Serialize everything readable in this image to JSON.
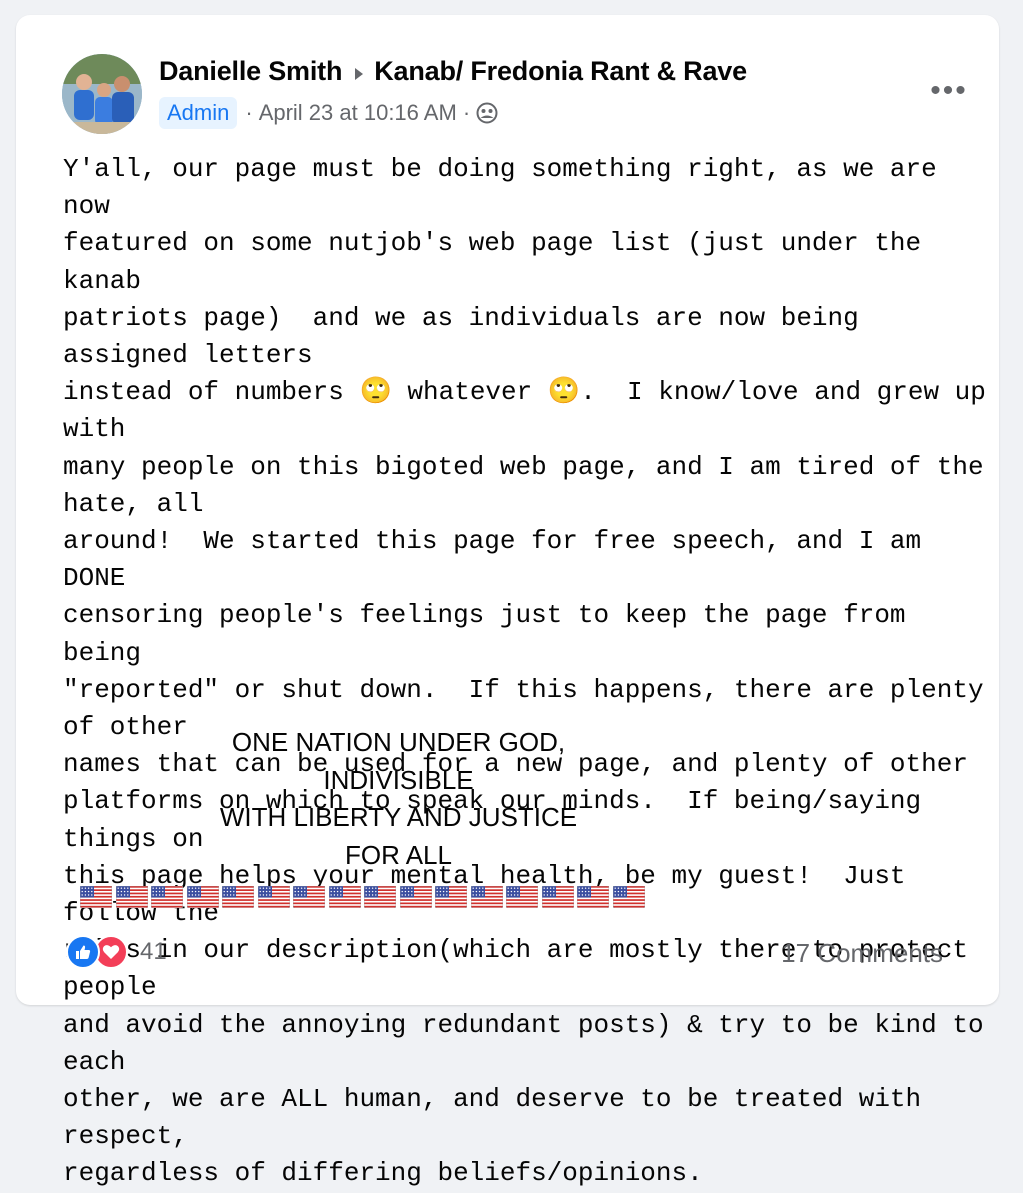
{
  "post": {
    "author": "Danielle Smith",
    "group": "Kanab/ Fredonia Rant & Rave",
    "badge": "Admin",
    "timestamp": "April 23 at 10:16 AM",
    "separator": "·",
    "audience_icon": "group-audience-icon",
    "more_label": "•••",
    "body": "Y'all, our page must be doing something right, as we are now\nfeatured on some nutjob's web page list (just under the kanab\npatriots page)  and we as individuals are now being assigned letters\ninstead of numbers 🙄 whatever 🙄.  I know/love and grew up with\nmany people on this bigoted web page, and I am tired of the hate, all\naround!  We started this page for free speech, and I am DONE\ncensoring people's feelings just to keep the page from being\n\"reported\" or shut down.  If this happens, there are plenty of other\nnames that can be used for a new page, and plenty of other\nplatforms on which to speak our minds.  If being/saying things on\nthis page helps your mental health, be my guest!  Just follow the\nrules in our description(which are mostly there to protect people\nand avoid the annoying redundant posts) & try to be kind to each\nother, we are ALL human, and deserve to be treated with respect,\nregardless of differing beliefs/opinions.",
    "pledge": [
      "ONE NATION UNDER GOD,",
      "INDIVISIBLE",
      "WITH LIBERTY AND JUSTICE",
      "FOR ALL"
    ],
    "flag_count": 16
  },
  "footer": {
    "reaction_count": "41",
    "comments": "17 Comments"
  },
  "colors": {
    "accent": "#1877f2",
    "love": "#f33e58",
    "secondary_text": "#65676b",
    "badge_bg": "#e7f3ff"
  }
}
